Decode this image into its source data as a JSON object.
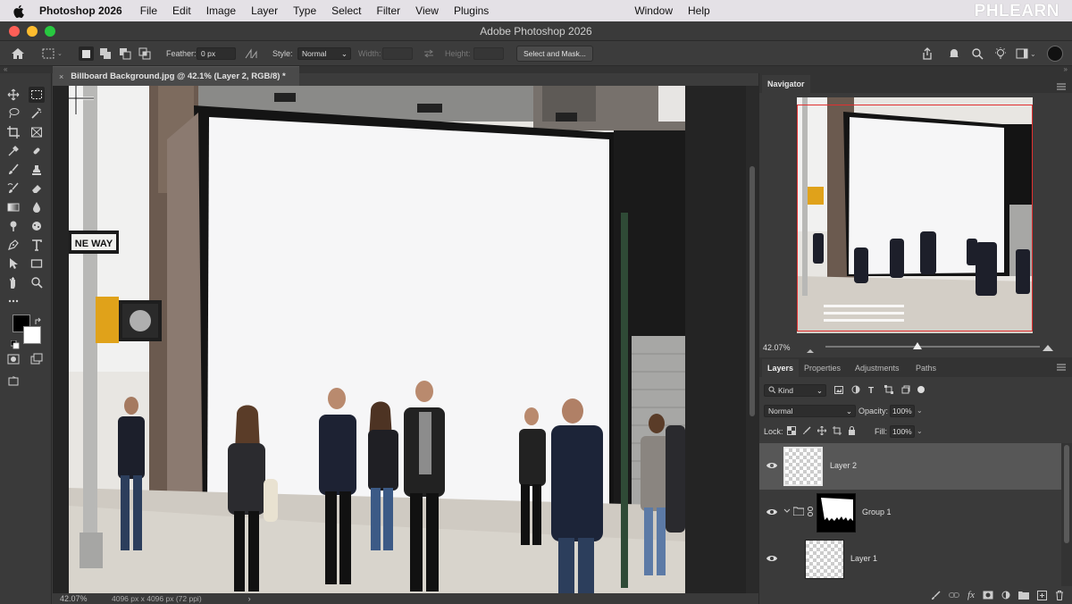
{
  "menubar": {
    "app_name": "Photoshop 2026",
    "items": [
      "File",
      "Edit",
      "Image",
      "Layer",
      "Type",
      "Select",
      "Filter",
      "View",
      "Plugins",
      "Window",
      "Help"
    ],
    "watermark": "PHLEARN"
  },
  "window": {
    "title": "Adobe Photoshop 2026"
  },
  "options": {
    "feather_label": "Feather:",
    "feather_value": "0 px",
    "style_label": "Style:",
    "style_value": "Normal",
    "width_label": "Width:",
    "height_label": "Height:",
    "select_mask_label": "Select and Mask..."
  },
  "document": {
    "tab_title": "Billboard Background.jpg @ 42.1% (Layer 2, RGB/8) *",
    "status_zoom": "42.07%",
    "status_info": "4096 px x 4096 px (72 ppi)",
    "status_arrow": "›",
    "scene_signs": {
      "street_sign": "NE WAY"
    }
  },
  "navigator": {
    "tab_label": "Navigator",
    "zoom": "42.07%",
    "zoom_level": 0.42
  },
  "layers_panel": {
    "tabs": [
      "Layers",
      "Properties",
      "Adjustments",
      "Paths"
    ],
    "active_tab": "Layers",
    "filter_label": "Kind",
    "blend_mode": "Normal",
    "opacity_label": "Opacity:",
    "opacity_value": "100%",
    "lock_label": "Lock:",
    "fill_label": "Fill:",
    "fill_value": "100%",
    "layers": [
      {
        "name": "Layer 2",
        "selected": true,
        "visible": true,
        "type": "pixel"
      },
      {
        "name": "Group 1",
        "selected": false,
        "visible": true,
        "type": "group"
      },
      {
        "name": "Layer 1",
        "selected": false,
        "visible": true,
        "type": "pixel"
      }
    ],
    "bottom_icons": [
      "brush-icon",
      "link-icon",
      "fx-icon",
      "mask-icon",
      "adjustment-icon",
      "folder-icon",
      "new-layer-icon",
      "trash-icon"
    ]
  },
  "colors": {
    "accent_red": "#e03030",
    "panel_bg": "#3a3a3a",
    "selected_layer": "#575757"
  }
}
